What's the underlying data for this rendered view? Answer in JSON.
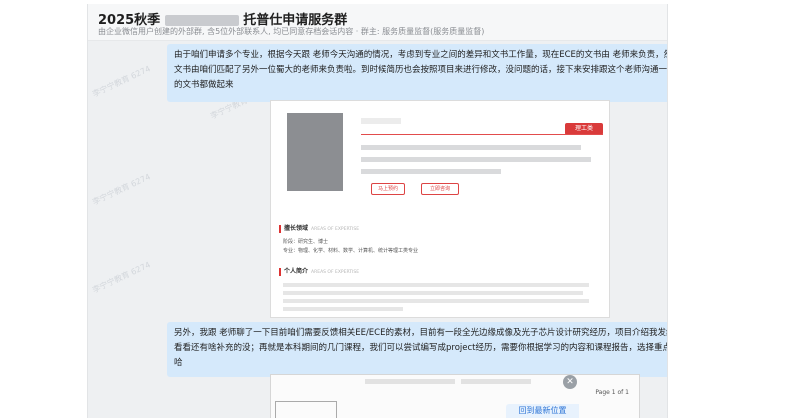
{
  "header": {
    "title_prefix": "2025秋季",
    "title_suffix": "托普仕申请服务群",
    "subtitle": "由企业微信用户创建的外部群, 含5位外部联系人, 均已同意存档会话内容 · 群主: 服务质量监督(服务质量监督)"
  },
  "messages": [
    {
      "text": "由于咱们申请多个专业，根据今天跟  老师今天沟通的情况，考虑到专业之间的差异和文书工作量，现在ECE的文书由  老师来负责，然后物理+材料项目文书由咱们匹配了另外一位蜀大的老师来负责啦。到时候简历也会按照项目来进行修改，没问题的话，接下来安排跟这个老师沟通一下，三个专业方向的文书都做起来"
    },
    {
      "text": "另外，我跟  老师聊了一下目前咱们需要反馈相关EE/ECE的素材，目前有一段全光边缘成像及光子芯片设计研究经历，项目介绍我发给了，除此之外你看看还有啥补充的没；再就是本科期间的几门课程，我们可以尝试编写成project经历，需要你根据学习的内容和课程报告，选择重点的内容整合发过来哈"
    }
  ],
  "profile_card": {
    "tag": "理工类",
    "btn_contact": "马上预约",
    "btn_consult": "立即咨询",
    "sec_areas": "擅长领域",
    "sec_areas_en": "AREAS OF EXPERTISE",
    "area_line1": "阶段：研究生、博士",
    "area_line2": "专业：物理、化学、材料、数学、计算机、统计等理工类专业",
    "sec_intro": "个人简介",
    "sec_intro_en": "AREAS OF EXPERTISE"
  },
  "document": {
    "page_label": "Page 1 of 1"
  },
  "watermark": "李宁宁教育 6274",
  "controls": {
    "close_glyph": "✕",
    "back_to_bottom": "回到最新位置"
  }
}
